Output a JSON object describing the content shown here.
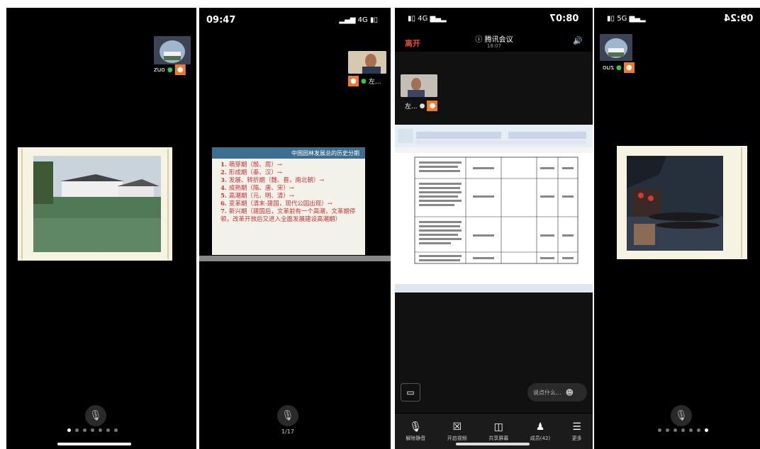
{
  "panel1": {
    "badge_name": "zuo",
    "pager_count": 7,
    "pager_active": 0
  },
  "panel2": {
    "time": "09:47",
    "signal": "4G",
    "participant_label": "左...",
    "slide": {
      "title": "中国园林发展总的历史分期",
      "items": [
        {
          "num": "1.",
          "text": "萌芽期（殷、周）→"
        },
        {
          "num": "2.",
          "text": "形成期（秦、汉）→"
        },
        {
          "num": "3.",
          "text": "发展、转折期（魏、晋，南北朝）→"
        },
        {
          "num": "4.",
          "text": "成熟期（隋、唐、宋）→"
        },
        {
          "num": "5.",
          "text": "高潮期（元、明、清）→"
        },
        {
          "num": "6.",
          "text": "变革期（清末-建国，现代公园出现）→"
        },
        {
          "num": "7.",
          "text": "新兴期（建国后，文革前有一个高潮，文革期停顿，改革开放后又进入全面发展建设高潮期）"
        }
      ]
    },
    "page_indicator": "1/17"
  },
  "panel3": {
    "time": "08:07",
    "signal": "4G",
    "leave_label": "离开",
    "meeting_title": "腾讯会议",
    "meeting_sub": "18:07",
    "participant_label": "左...",
    "chat_placeholder": "说点什么...",
    "toolbar": [
      {
        "icon": "mic-muted",
        "label": "解除静音"
      },
      {
        "icon": "video-off",
        "label": "开启视频"
      },
      {
        "icon": "screen-share",
        "label": "共享屏幕"
      },
      {
        "icon": "members",
        "label": "成员(42)"
      },
      {
        "icon": "more",
        "label": "更多"
      }
    ]
  },
  "panel4": {
    "time": "09:24",
    "signal": "5G",
    "badge_name": "zuo",
    "pager_count": 7,
    "pager_active": 6
  }
}
